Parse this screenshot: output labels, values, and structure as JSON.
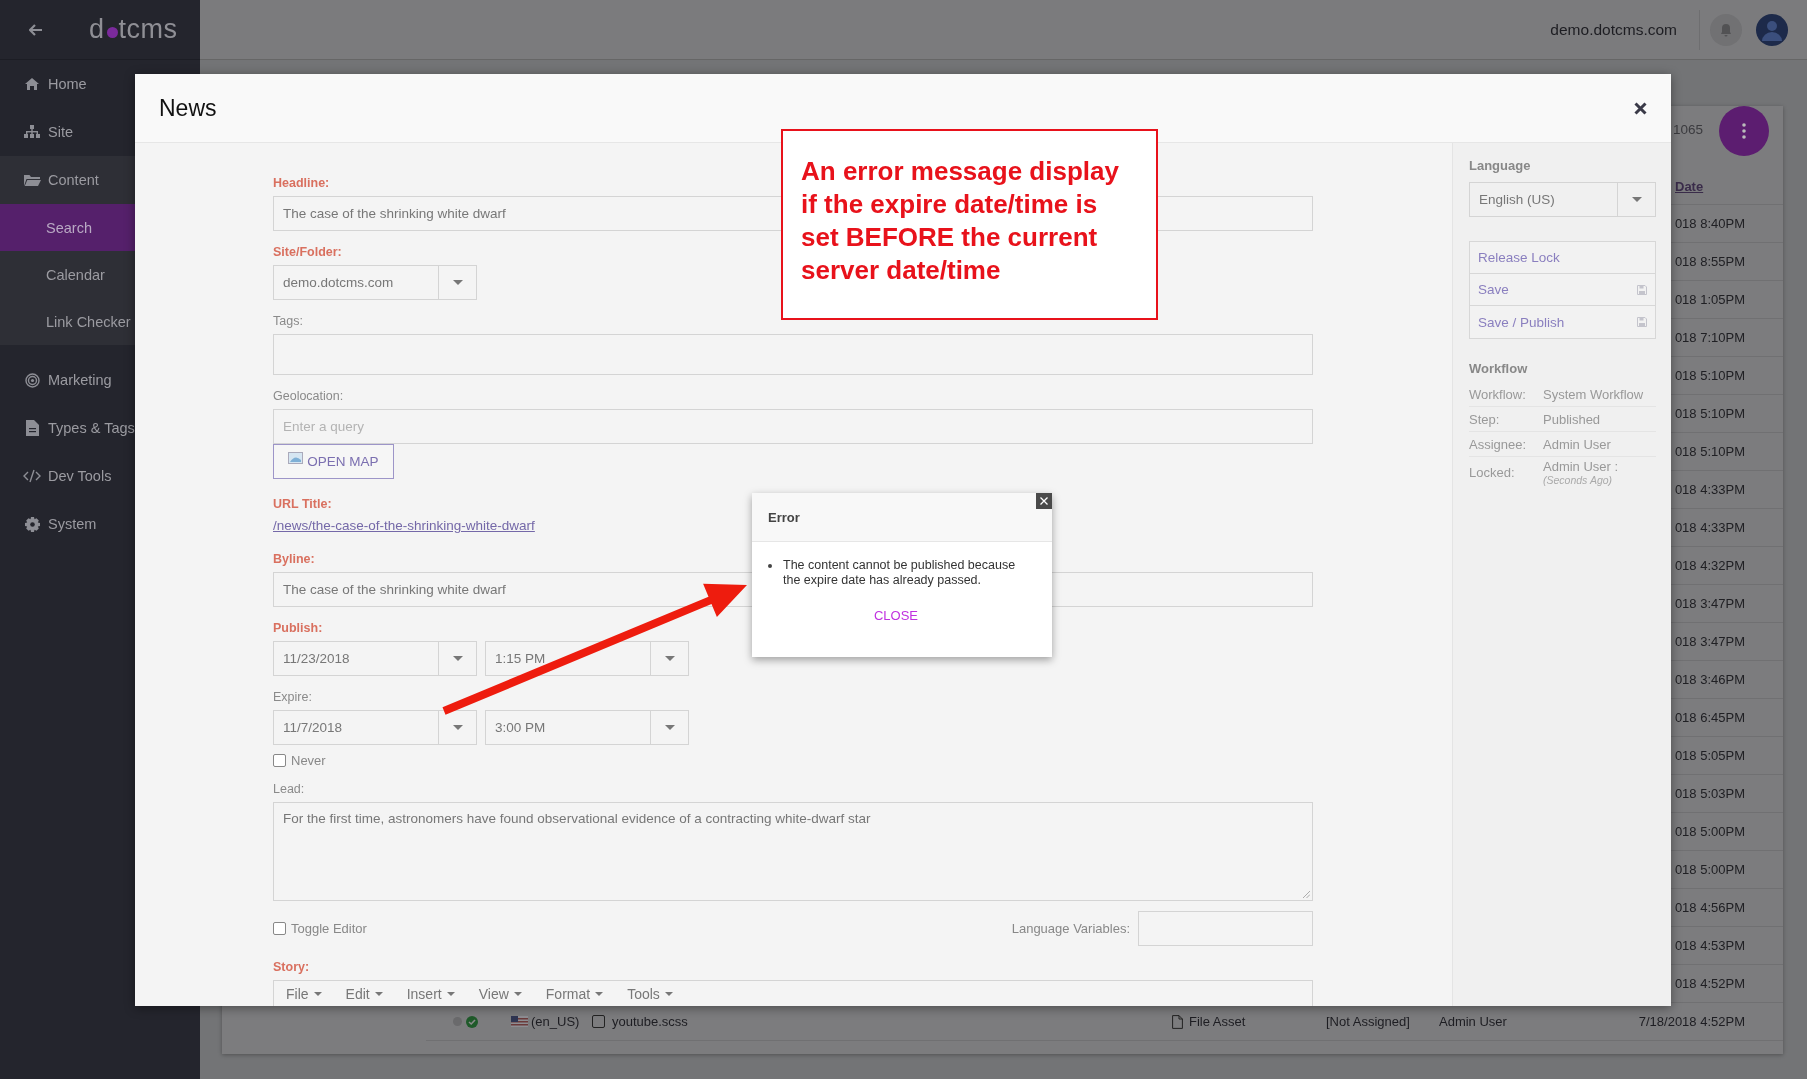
{
  "header": {
    "logo_left": "d",
    "logo_right": "tcms",
    "site": "demo.dotcms.com"
  },
  "sidebar": {
    "items": [
      {
        "label": "Home",
        "selected": false
      },
      {
        "label": "Site",
        "selected": false
      },
      {
        "label": "Content",
        "selected": false,
        "children": [
          {
            "label": "Search",
            "selected": true
          },
          {
            "label": "Calendar",
            "selected": false
          },
          {
            "label": "Link Checker",
            "selected": false
          }
        ]
      },
      {
        "label": "Marketing",
        "selected": false
      },
      {
        "label": "Types & Tags",
        "selected": false
      },
      {
        "label": "Dev Tools",
        "selected": false
      },
      {
        "label": "System",
        "selected": false
      }
    ]
  },
  "list": {
    "count": "1065",
    "date_header": "Date",
    "dates": [
      "018 8:40PM",
      "018 8:55PM",
      "018 1:05PM",
      "018 7:10PM",
      "018 5:10PM",
      "018 5:10PM",
      "018 5:10PM",
      "018 4:33PM",
      "018 4:33PM",
      "018 4:32PM",
      "018 3:47PM",
      "018 3:47PM",
      "018 3:46PM",
      "018 6:45PM",
      "018 5:05PM",
      "018 5:03PM",
      "018 5:00PM",
      "018 5:00PM",
      "018 4:56PM",
      "018 4:53PM",
      "018 4:52PM"
    ],
    "rows": [
      {
        "checked": false,
        "language": "(en_US)",
        "title": "youtube.scss",
        "type": "File Asset",
        "step": "[Not Assigned]",
        "assignee": "Admin User",
        "date": "7/18/2018 4:52PM"
      }
    ]
  },
  "modal": {
    "title": "News",
    "fields": [
      {
        "kind": "text",
        "label": "Headline:",
        "required": true,
        "value": "The case of the shrinking white dwarf"
      },
      {
        "kind": "select",
        "label": "Site/Folder:",
        "required": true,
        "value": "demo.dotcms.com"
      },
      {
        "kind": "tags",
        "label": "Tags:",
        "required": false
      },
      {
        "kind": "geo",
        "label": "Geolocation:",
        "required": false,
        "placeholder": "Enter a query",
        "button": "OPEN MAP"
      },
      {
        "kind": "link",
        "label": "URL Title:",
        "required": true,
        "value": "/news/the-case-of-the-shrinking-white-dwarf"
      },
      {
        "kind": "text",
        "label": "Byline:",
        "required": true,
        "value": "The case of the shrinking white dwarf"
      },
      {
        "kind": "datetime",
        "label": "Publish:",
        "required": true,
        "date": "11/23/2018",
        "time": "1:15 PM"
      },
      {
        "kind": "datetime",
        "label": "Expire:",
        "required": false,
        "date": "11/7/2018",
        "time": "3:00 PM",
        "never": {
          "label": "Never",
          "checked": false
        }
      },
      {
        "kind": "textarea",
        "label": "Lead:",
        "required": false,
        "value": "For the first time, astronomers have found observational evidence of a contracting white-dwarf star"
      },
      {
        "kind": "toggle",
        "checkbox": {
          "label": "Toggle Editor",
          "checked": false
        },
        "side_label": "Language Variables:"
      },
      {
        "kind": "editor",
        "label": "Story:",
        "required": true,
        "menus": [
          "File",
          "Edit",
          "Insert",
          "View",
          "Format",
          "Tools"
        ]
      }
    ],
    "panel": {
      "language": {
        "label": "Language",
        "value": "English (US)"
      },
      "actions": [
        {
          "label": "Release Lock",
          "kind": "plain"
        },
        {
          "label": "Save",
          "kind": "save"
        },
        {
          "label": "Save / Publish",
          "kind": "save"
        }
      ],
      "workflow": {
        "title": "Workflow",
        "rows": [
          {
            "label": "Workflow:",
            "value": "System Workflow"
          },
          {
            "label": "Step:",
            "value": "Published"
          },
          {
            "label": "Assignee:",
            "value": "Admin User"
          },
          {
            "label": "Locked:",
            "value": "Admin User :",
            "note": "(Seconds Ago)"
          }
        ]
      }
    }
  },
  "error_dialog": {
    "title": "Error",
    "messages": [
      "The content cannot be published because the expire date has already passed."
    ],
    "button": "CLOSE"
  },
  "annotation": {
    "text": "An error message display if the expire date/time is set BEFORE the current server date/time"
  }
}
